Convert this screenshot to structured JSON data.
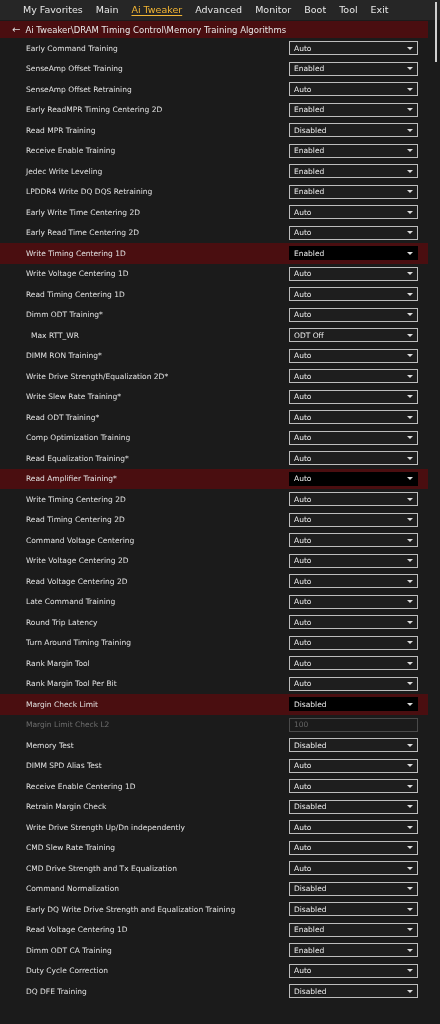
{
  "tabs": [
    {
      "label": "My Favorites",
      "selected": false
    },
    {
      "label": "Main",
      "selected": false
    },
    {
      "label": "Ai Tweaker",
      "selected": true
    },
    {
      "label": "Advanced",
      "selected": false
    },
    {
      "label": "Monitor",
      "selected": false
    },
    {
      "label": "Boot",
      "selected": false
    },
    {
      "label": "Tool",
      "selected": false
    },
    {
      "label": "Exit",
      "selected": false
    }
  ],
  "breadcrumb": {
    "back_glyph": "←",
    "path": "Ai Tweaker\\DRAM Timing Control\\Memory Training Algorithms"
  },
  "settings": [
    {
      "kind": "dropdown",
      "label": "Early Command Training",
      "value": "Auto",
      "selected": false,
      "disabled": false
    },
    {
      "kind": "dropdown",
      "label": "SenseAmp Offset Training",
      "value": "Enabled",
      "selected": false,
      "disabled": false
    },
    {
      "kind": "dropdown",
      "label": "SenseAmp Offset Retraining",
      "value": "Auto",
      "selected": false,
      "disabled": false
    },
    {
      "kind": "dropdown",
      "label": "Early ReadMPR Timing Centering 2D",
      "value": "Enabled",
      "selected": false,
      "disabled": false
    },
    {
      "kind": "dropdown",
      "label": "Read MPR Training",
      "value": "Disabled",
      "selected": false,
      "disabled": false
    },
    {
      "kind": "dropdown",
      "label": "Receive Enable Training",
      "value": "Enabled",
      "selected": false,
      "disabled": false
    },
    {
      "kind": "dropdown",
      "label": "Jedec Write Leveling",
      "value": "Enabled",
      "selected": false,
      "disabled": false
    },
    {
      "kind": "dropdown",
      "label": "LPDDR4 Write DQ DQS Retraining",
      "value": "Enabled",
      "selected": false,
      "disabled": false
    },
    {
      "kind": "dropdown",
      "label": "Early Write Time Centering 2D",
      "value": "Auto",
      "selected": false,
      "disabled": false
    },
    {
      "kind": "dropdown",
      "label": "Early Read Time Centering 2D",
      "value": "Auto",
      "selected": false,
      "disabled": false
    },
    {
      "kind": "dropdown",
      "label": "Write Timing Centering 1D",
      "value": "Enabled",
      "selected": true,
      "disabled": false
    },
    {
      "kind": "dropdown",
      "label": "Write Voltage Centering 1D",
      "value": "Auto",
      "selected": false,
      "disabled": false
    },
    {
      "kind": "dropdown",
      "label": "Read Timing Centering 1D",
      "value": "Auto",
      "selected": false,
      "disabled": false
    },
    {
      "kind": "dropdown",
      "label": "Dimm ODT Training*",
      "value": "Auto",
      "selected": false,
      "disabled": false,
      "children": [
        {
          "kind": "dropdown",
          "label": "Max RTT_WR",
          "value": "ODT Off",
          "selected": false,
          "disabled": false
        }
      ]
    },
    {
      "kind": "dropdown",
      "label": "DIMM RON Training*",
      "value": "Auto",
      "selected": false,
      "disabled": false
    },
    {
      "kind": "dropdown",
      "label": "Write Drive Strength/Equalization 2D*",
      "value": "Auto",
      "selected": false,
      "disabled": false
    },
    {
      "kind": "dropdown",
      "label": "Write Slew Rate Training*",
      "value": "Auto",
      "selected": false,
      "disabled": false
    },
    {
      "kind": "dropdown",
      "label": "Read ODT Training*",
      "value": "Auto",
      "selected": false,
      "disabled": false
    },
    {
      "kind": "dropdown",
      "label": "Comp Optimization Training",
      "value": "Auto",
      "selected": false,
      "disabled": false
    },
    {
      "kind": "dropdown",
      "label": "Read Equalization Training*",
      "value": "Auto",
      "selected": false,
      "disabled": false
    },
    {
      "kind": "dropdown",
      "label": "Read Amplifier Training*",
      "value": "Auto",
      "selected": true,
      "disabled": false
    },
    {
      "kind": "dropdown",
      "label": "Write Timing Centering 2D",
      "value": "Auto",
      "selected": false,
      "disabled": false
    },
    {
      "kind": "dropdown",
      "label": "Read Timing Centering 2D",
      "value": "Auto",
      "selected": false,
      "disabled": false
    },
    {
      "kind": "dropdown",
      "label": "Command Voltage Centering",
      "value": "Auto",
      "selected": false,
      "disabled": false
    },
    {
      "kind": "dropdown",
      "label": "Write Voltage Centering 2D",
      "value": "Auto",
      "selected": false,
      "disabled": false
    },
    {
      "kind": "dropdown",
      "label": "Read Voltage Centering 2D",
      "value": "Auto",
      "selected": false,
      "disabled": false
    },
    {
      "kind": "dropdown",
      "label": "Late Command Training",
      "value": "Auto",
      "selected": false,
      "disabled": false
    },
    {
      "kind": "dropdown",
      "label": "Round Trip Latency",
      "value": "Auto",
      "selected": false,
      "disabled": false
    },
    {
      "kind": "dropdown",
      "label": "Turn Around Timing Training",
      "value": "Auto",
      "selected": false,
      "disabled": false
    },
    {
      "kind": "dropdown",
      "label": "Rank Margin Tool",
      "value": "Auto",
      "selected": false,
      "disabled": false
    },
    {
      "kind": "dropdown",
      "label": "Rank Margin Tool Per Bit",
      "value": "Auto",
      "selected": false,
      "disabled": false
    },
    {
      "kind": "dropdown",
      "label": "Margin Check Limit",
      "value": "Disabled",
      "selected": true,
      "disabled": false
    },
    {
      "kind": "field",
      "label": "Margin Limit Check L2",
      "value": "100",
      "selected": false,
      "disabled": true
    },
    {
      "kind": "dropdown",
      "label": "Memory Test",
      "value": "Disabled",
      "selected": false,
      "disabled": false
    },
    {
      "kind": "dropdown",
      "label": "DIMM SPD Alias Test",
      "value": "Auto",
      "selected": false,
      "disabled": false
    },
    {
      "kind": "dropdown",
      "label": "Receive Enable Centering 1D",
      "value": "Auto",
      "selected": false,
      "disabled": false
    },
    {
      "kind": "dropdown",
      "label": "Retrain Margin Check",
      "value": "Disabled",
      "selected": false,
      "disabled": false
    },
    {
      "kind": "dropdown",
      "label": "Write Drive Strength Up/Dn independently",
      "value": "Auto",
      "selected": false,
      "disabled": false
    },
    {
      "kind": "dropdown",
      "label": "CMD Slew Rate Training",
      "value": "Auto",
      "selected": false,
      "disabled": false
    },
    {
      "kind": "dropdown",
      "label": "CMD Drive Strength and Tx Equalization",
      "value": "Auto",
      "selected": false,
      "disabled": false
    },
    {
      "kind": "dropdown",
      "label": "Command Normalization",
      "value": "Disabled",
      "selected": false,
      "disabled": false
    },
    {
      "kind": "dropdown",
      "label": "Early DQ Write Drive Strength and Equalization Training",
      "value": "Disabled",
      "selected": false,
      "disabled": false
    },
    {
      "kind": "dropdown",
      "label": "Read Voltage Centering 1D",
      "value": "Enabled",
      "selected": false,
      "disabled": false
    },
    {
      "kind": "dropdown",
      "label": "Dimm ODT CA Training",
      "value": "Enabled",
      "selected": false,
      "disabled": false
    },
    {
      "kind": "dropdown",
      "label": "Duty Cycle Correction",
      "value": "Auto",
      "selected": false,
      "disabled": false
    },
    {
      "kind": "dropdown",
      "label": "DQ DFE Training",
      "value": "Disabled",
      "selected": false,
      "disabled": false
    }
  ]
}
